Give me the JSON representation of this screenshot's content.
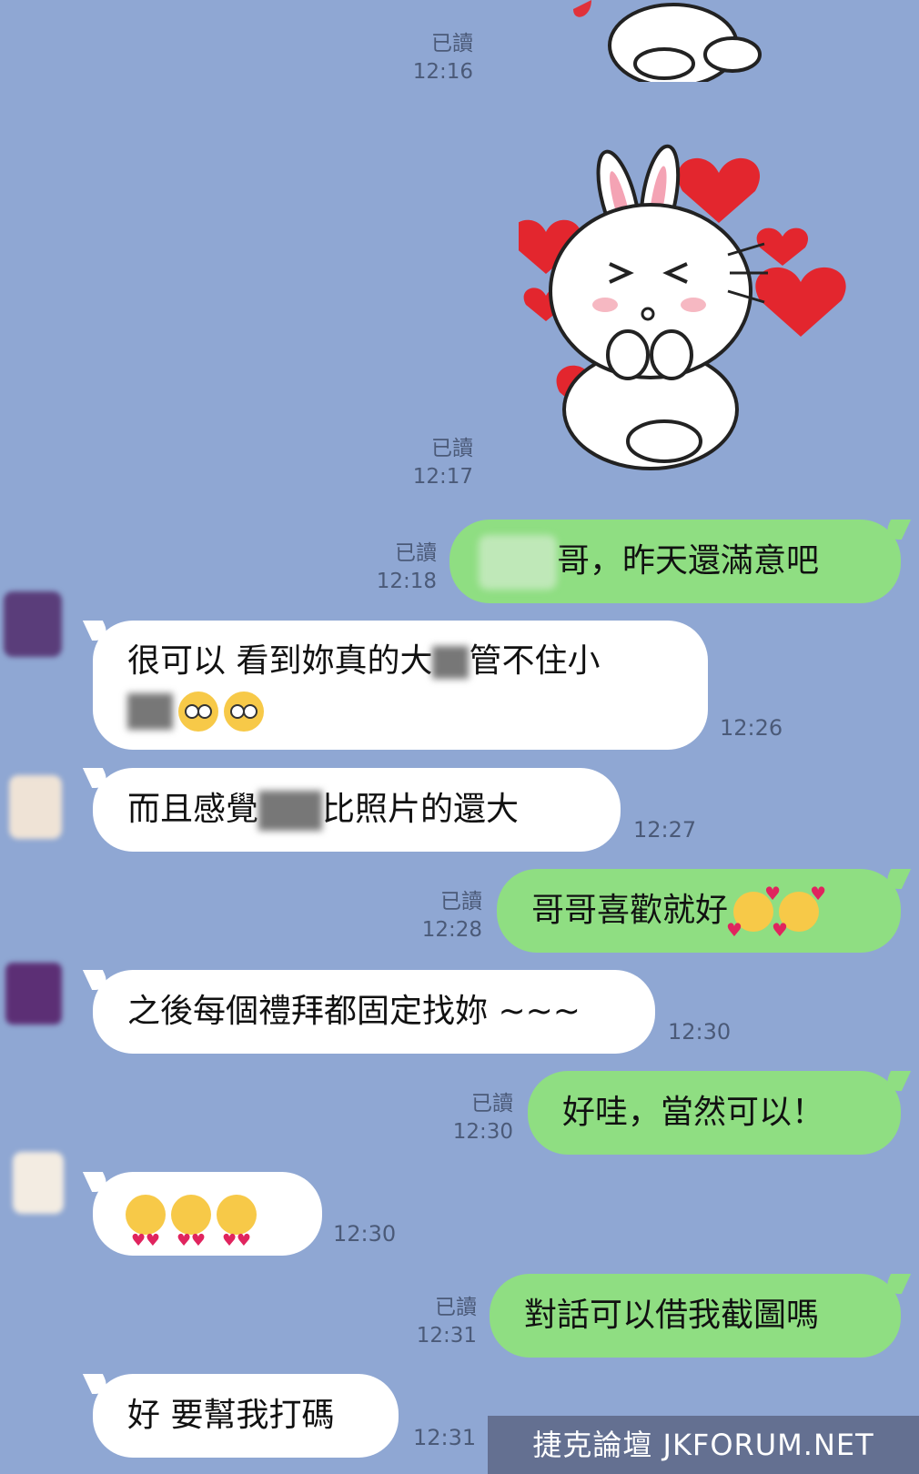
{
  "stickers": [
    {
      "name": "rabbit-sticker-top",
      "read": "已讀",
      "time": "12:16"
    },
    {
      "name": "rabbit-sticker-hearts",
      "read": "已讀",
      "time": "12:17"
    }
  ],
  "messages": [
    {
      "dir": "out",
      "read": "已讀",
      "time": "12:18",
      "text_visible": "哥，昨天還滿意吧"
    },
    {
      "dir": "in",
      "time": "12:26",
      "line1_a": "很可以 看到妳真的大",
      "line1_b": "管不住小"
    },
    {
      "dir": "in",
      "time": "12:27",
      "text_a": "而且感覺",
      "text_b": "比照片的還大"
    },
    {
      "dir": "out",
      "read": "已讀",
      "time": "12:28",
      "text": "哥哥喜歡就好"
    },
    {
      "dir": "in",
      "time": "12:30",
      "text": "之後每個禮拜都固定找妳 ~~~"
    },
    {
      "dir": "out",
      "read": "已讀",
      "time": "12:30",
      "text": "好哇，當然可以！"
    },
    {
      "dir": "in",
      "time": "12:30",
      "text": ""
    },
    {
      "dir": "out",
      "read": "已讀",
      "time": "12:31",
      "text": "對話可以借我截圖嗎"
    },
    {
      "dir": "in",
      "time": "12:31",
      "text": "好 要幫我打碼"
    }
  ],
  "watermark": "捷克論壇 JKFORUM.NET",
  "colors": {
    "background": "#8fa7d3",
    "outgoing": "#8fde82",
    "incoming": "#ffffff"
  }
}
